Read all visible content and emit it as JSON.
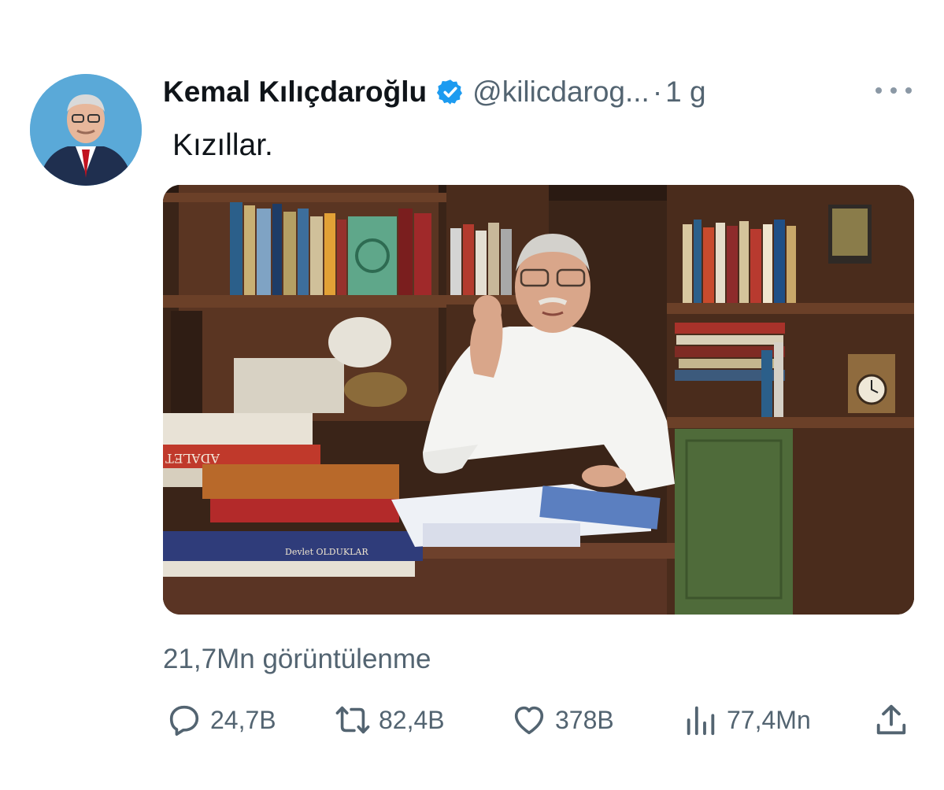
{
  "author": {
    "name": "Kemal Kılıçdaroğlu",
    "handle": "@kilicdarog...",
    "separator": "·",
    "time": "1 g"
  },
  "tweet": {
    "text": "Kızıllar."
  },
  "media": {
    "book_spine_label": "ADALET",
    "book_cover_label": "Devlet OLDUKLAR"
  },
  "stats": {
    "views_text": "21,7Mn görüntülenme"
  },
  "actions": {
    "replies": "24,7B",
    "retweets": "82,4B",
    "likes": "378B",
    "analytics": "77,4Mn"
  },
  "colors": {
    "verified": "#1d9bf0",
    "secondary_text": "#536471",
    "primary_text": "#0f1419"
  },
  "icons": [
    "verified-badge-icon",
    "more-icon",
    "mute-icon",
    "reply-icon",
    "retweet-icon",
    "like-icon",
    "analytics-icon",
    "share-icon"
  ]
}
